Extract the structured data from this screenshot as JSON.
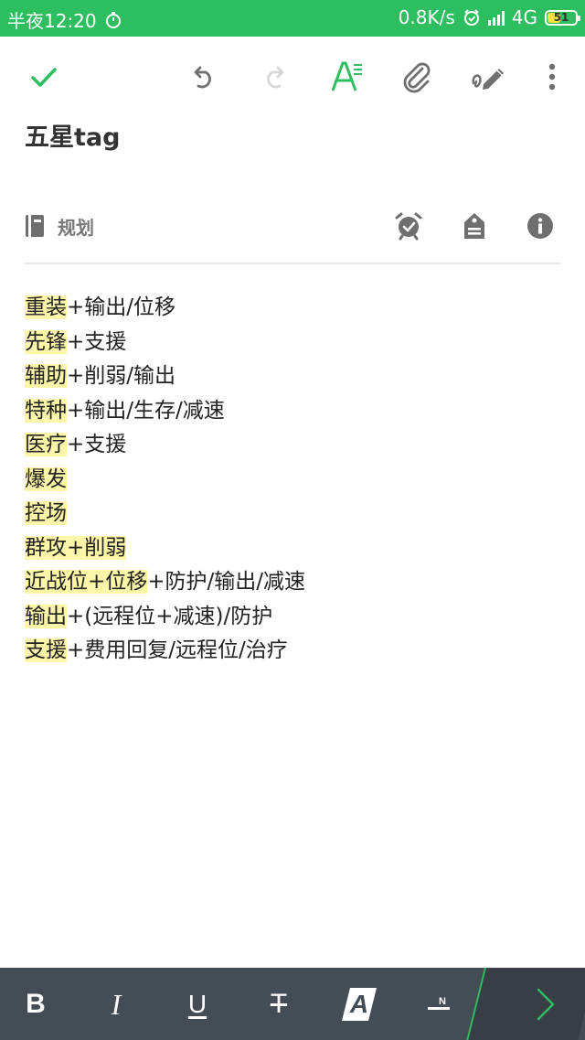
{
  "status_bar": {
    "time": "半夜12:20",
    "net_speed": "0.8K/s",
    "network": "4G",
    "battery": "51",
    "battery_level": 0.51
  },
  "toolbar": {
    "icons": [
      "check-icon",
      "undo-icon",
      "redo-icon",
      "text-format-icon",
      "paperclip-icon",
      "handwriting-icon",
      "more-icon"
    ]
  },
  "note": {
    "title": "五星tag",
    "notebook": "规划"
  },
  "body_lines": [
    {
      "h": "重装",
      "rest": "+输出/位移"
    },
    {
      "h": "先锋",
      "rest": "+支援"
    },
    {
      "h": "辅助",
      "rest": "+削弱/输出"
    },
    {
      "h": "特种",
      "rest": "+输出/生存/减速"
    },
    {
      "h": "医疗",
      "rest": "+支援"
    },
    {
      "h": "爆发",
      "rest": ""
    },
    {
      "h": "控场",
      "rest": ""
    },
    {
      "h": "群攻+削弱",
      "rest": ""
    },
    {
      "h": "近战位+位移",
      "rest": "+防护/输出/减速"
    },
    {
      "h": "输出",
      "rest": "+(远程位+减速)/防护"
    },
    {
      "h": "支援",
      "rest": "+费用回复/远程位/治疗"
    }
  ],
  "format_bar": {
    "bold": "B",
    "italic": "I",
    "underline": "U",
    "strikethrough": "T",
    "highlight": "A"
  },
  "colors": {
    "accent": "#2dbe60",
    "highlight": "#fdf6a8",
    "format_bar": "#444c55"
  }
}
